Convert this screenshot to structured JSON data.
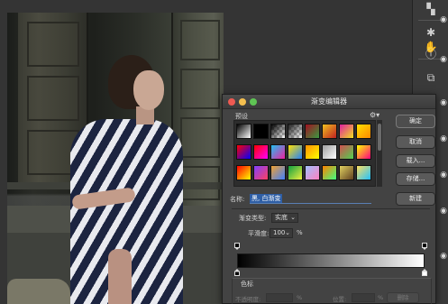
{
  "dialog": {
    "title": "渐变编辑器",
    "presets_label": "预设",
    "buttons": {
      "ok": "确定",
      "cancel": "取消",
      "load": "载入...",
      "save": "存储...",
      "new": "新建"
    },
    "name_label": "名称:",
    "name_value": "黑, 白渐变",
    "gradient_type_label": "渐变类型:",
    "gradient_type_value": "实底",
    "smoothness_label": "平滑度:",
    "smoothness_value": "100",
    "smoothness_unit": "%",
    "color_stops_label": "色标",
    "opacity_label": "不透明度:",
    "opacity_unit": "%",
    "location_label": "位置:",
    "location_unit": "%",
    "delete_label": "删除",
    "traffic_colors": [
      "#ee5a52",
      "#f4bf4f",
      "#5fc454"
    ]
  },
  "presets": [
    [
      "#000000|#ffffff",
      "#000000|#000000",
      "#000000|transparent",
      "#222222|transparent",
      "#a01020|#3a9a40",
      "#f0c020|#c02020",
      "#e020a0|#f0e020",
      "#ffe000|#ff8800"
    ],
    [
      "#f00|#00f",
      "#f00|#f0f",
      "#20c0f0|#f020a0",
      "#ffe000|#2080ff",
      "#ff9000|#ffff00",
      "#a0a0a0|#ffffff",
      "#d05050|#50d050",
      "#ffff00|#ff0080"
    ],
    [
      "#ff0000|#ffff00",
      "#8040ff|#ff4060",
      "#f0a030|#4080ff",
      "#10a040|#f0f040",
      "#a0c0ff|#ff80c0",
      "#ff8000|#40ff80",
      "#e0d060|#604020",
      "#ffe060|#20c0ff"
    ]
  ],
  "toolbar_icons": [
    "arrange-icon",
    "transform-icon",
    "hand-icon",
    "info-icon",
    "layers-icon"
  ],
  "layer_visibility": [
    "eye-icon",
    "eye-icon",
    "eye-icon",
    "eye-icon",
    "eye-icon",
    "eye-icon",
    "eye-icon"
  ]
}
